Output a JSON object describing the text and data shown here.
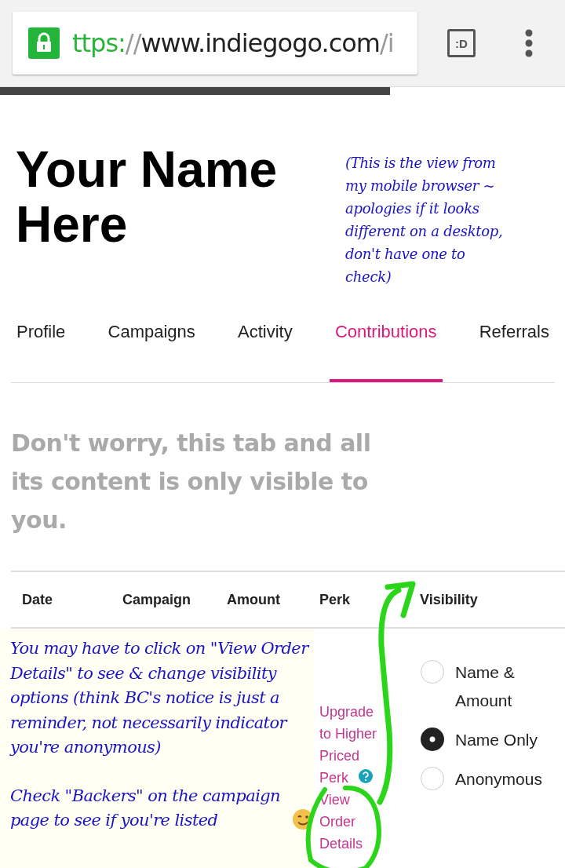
{
  "browser": {
    "url_scheme": "ttps:",
    "url_slashes": "//",
    "url_host": "www.indiegogo.com",
    "url_tail": "/i",
    "tab_switcher": ":D",
    "secure": true,
    "load": {
      "level": 0.69
    }
  },
  "profile": {
    "name": "Your Name Here"
  },
  "note": "(This is the view from my mobile browser ~ apologies if it looks different on a desktop, don't have one to check)",
  "tabs": [
    {
      "label": "Profile",
      "selected": false
    },
    {
      "label": "Campaigns",
      "selected": false
    },
    {
      "label": "Activity",
      "selected": false
    },
    {
      "label": "Contributions",
      "selected": true
    },
    {
      "label": "Referrals",
      "selected": false
    }
  ],
  "notice": "Don't worry, this tab and all its content is only visible to you.",
  "table": {
    "columns": [
      "Date",
      "Campaign",
      "Amount",
      "Perk",
      "Visibility"
    ],
    "row": {
      "annotations": [
        "You may have to click on \"View Order Details\" to see & change visibility options (think BC's notice is just a reminder, not necessarily indicator you're anonymous)",
        "Check \"Backers\" on the campaign page to see if you're listed"
      ],
      "perk_links": [
        {
          "label": "Upgrade to Higher Priced Perk",
          "help": true
        },
        {
          "label": "View Order Details",
          "help": false
        }
      ],
      "visibility": [
        {
          "label": "Name & Amount",
          "selected": false
        },
        {
          "label": "Name Only",
          "selected": true
        },
        {
          "label": "Anonymous",
          "selected": false
        }
      ]
    }
  }
}
